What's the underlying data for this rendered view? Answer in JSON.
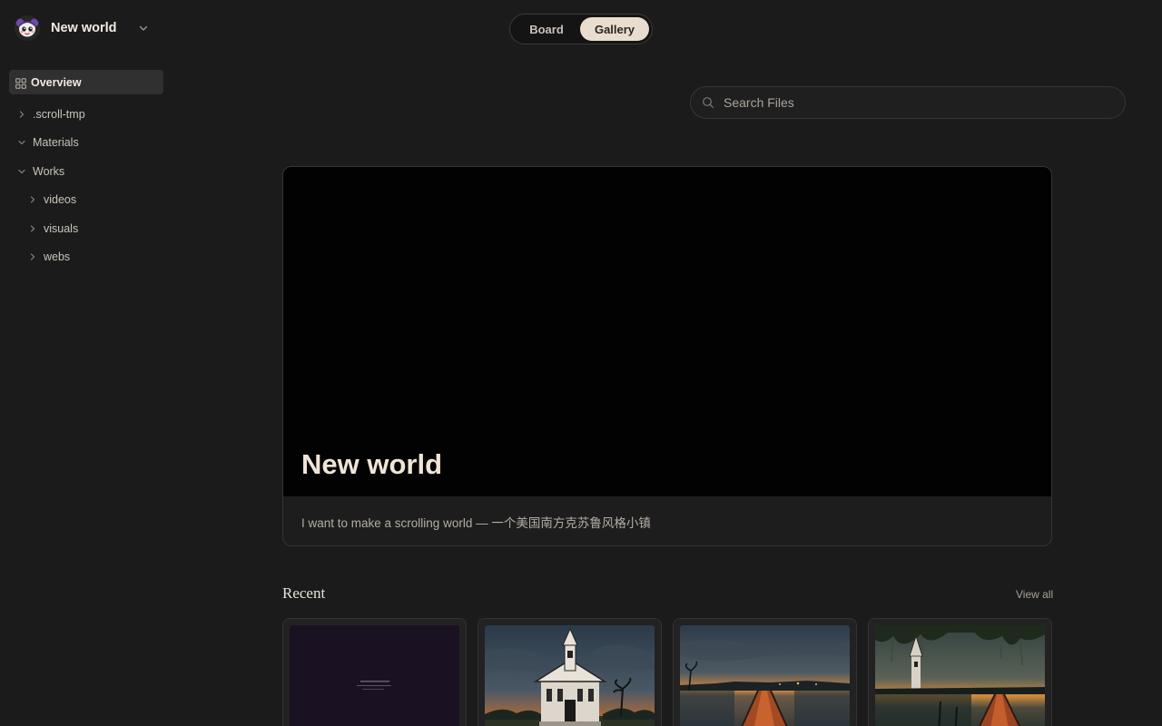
{
  "workspace": {
    "name": "New world"
  },
  "sidebar": {
    "overview_label": "Overview",
    "items": [
      {
        "label": ".scroll-tmp",
        "expanded": false,
        "depth": 0
      },
      {
        "label": "Materials",
        "expanded": true,
        "depth": 0
      },
      {
        "label": "Works",
        "expanded": true,
        "depth": 0
      },
      {
        "label": "videos",
        "expanded": false,
        "depth": 1
      },
      {
        "label": "visuals",
        "expanded": false,
        "depth": 1
      },
      {
        "label": "webs",
        "expanded": false,
        "depth": 1
      }
    ]
  },
  "view_toggle": {
    "options": [
      "Board",
      "Gallery"
    ],
    "selected": "Gallery"
  },
  "search": {
    "placeholder": "Search Files"
  },
  "hero": {
    "title": "New world",
    "description": "I want to make a scrolling world — 一个美国南方克苏鲁风格小镇"
  },
  "recent": {
    "title": "Recent",
    "view_all_label": "View all",
    "items": [
      {
        "kind": "web-page-thumbnail"
      },
      {
        "kind": "church-illustration"
      },
      {
        "kind": "pier-sunset-illustration"
      },
      {
        "kind": "swamp-church-pier-illustration"
      }
    ]
  },
  "colors": {
    "background": "#1b1b1b",
    "accent": "#e9ddcf",
    "hero_cover": "#020202"
  }
}
